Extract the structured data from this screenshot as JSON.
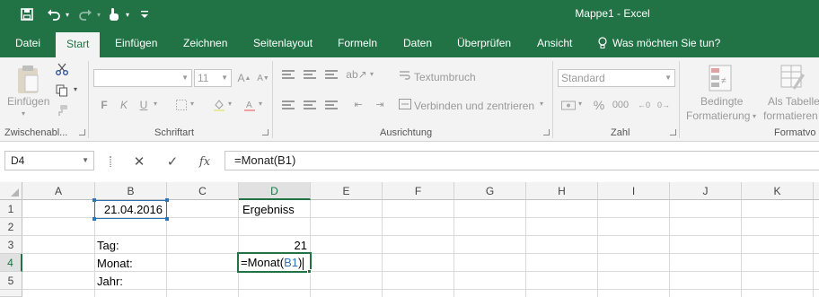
{
  "app": {
    "title": "Mappe1 - Excel",
    "accent": "#217346",
    "reference_color": "#2e75b6"
  },
  "qat": {
    "icons": [
      "save-icon",
      "undo-icon",
      "redo-icon",
      "touch-mode-icon",
      "customize-qat-icon"
    ]
  },
  "tabs": [
    "Datei",
    "Start",
    "Einfügen",
    "Zeichnen",
    "Seitenlayout",
    "Formeln",
    "Daten",
    "Überprüfen",
    "Ansicht"
  ],
  "active_tab": "Start",
  "tell_me": "Was möchten Sie tun?",
  "ribbon": {
    "clipboard": {
      "paste_label": "Einfügen",
      "group_label": "Zwischenabl..."
    },
    "font": {
      "font_name": "",
      "font_size": "11",
      "bold": "F",
      "italic": "K",
      "underline": "U",
      "group_label": "Schriftart"
    },
    "alignment": {
      "wrap_text": "Textumbruch",
      "merge_center": "Verbinden und zentrieren",
      "group_label": "Ausrichtung"
    },
    "number": {
      "format": "Standard",
      "percent": "%",
      "thousands": "000",
      "group_label": "Zahl"
    },
    "styles": {
      "conditional_1": "Bedingte",
      "conditional_2": "Formatierung",
      "as_table_1": "Als Tabelle",
      "as_table_2": "formatieren",
      "group_label": "Formatvo"
    }
  },
  "formula_bar": {
    "name_box": "D4",
    "cancel": "✕",
    "enter": "✓",
    "fx": "fx",
    "formula": "=Monat(B1)"
  },
  "sheet": {
    "columns": [
      "A",
      "B",
      "C",
      "D",
      "E",
      "F",
      "G",
      "H",
      "I",
      "J",
      "K"
    ],
    "rows": [
      "1",
      "2",
      "3",
      "4",
      "5"
    ],
    "active_column": "D",
    "active_row": "4",
    "cells": {
      "B1": "21.04.2016",
      "D1": "Ergebniss",
      "B3": "Tag:",
      "D3": "21",
      "B4": "Monat:",
      "B5": "Jahr:"
    },
    "editing": {
      "prefix": "=Monat(",
      "ref": "B1",
      "suffix": ")"
    }
  }
}
